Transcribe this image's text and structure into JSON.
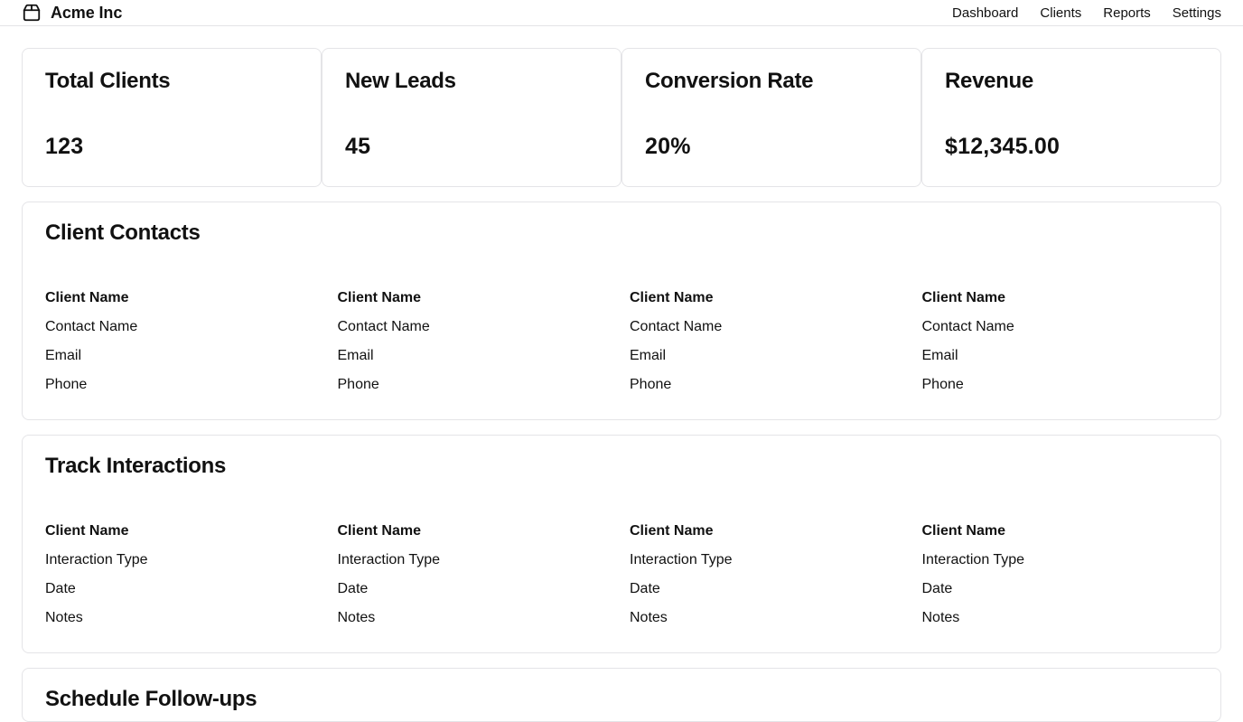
{
  "header": {
    "brand": "Acme Inc",
    "logo_icon": "package-icon",
    "nav": [
      "Dashboard",
      "Clients",
      "Reports",
      "Settings"
    ]
  },
  "stats": [
    {
      "title": "Total Clients",
      "value": "123"
    },
    {
      "title": "New Leads",
      "value": "45"
    },
    {
      "title": "Conversion Rate",
      "value": "20%"
    },
    {
      "title": "Revenue",
      "value": "$12,345.00"
    }
  ],
  "client_contacts": {
    "title": "Client Contacts",
    "columns": [
      {
        "name": "Client Name",
        "contact": "Contact Name",
        "email": "Email",
        "phone": "Phone"
      },
      {
        "name": "Client Name",
        "contact": "Contact Name",
        "email": "Email",
        "phone": "Phone"
      },
      {
        "name": "Client Name",
        "contact": "Contact Name",
        "email": "Email",
        "phone": "Phone"
      },
      {
        "name": "Client Name",
        "contact": "Contact Name",
        "email": "Email",
        "phone": "Phone"
      }
    ]
  },
  "track_interactions": {
    "title": "Track Interactions",
    "columns": [
      {
        "name": "Client Name",
        "type": "Interaction Type",
        "date": "Date",
        "notes": "Notes"
      },
      {
        "name": "Client Name",
        "type": "Interaction Type",
        "date": "Date",
        "notes": "Notes"
      },
      {
        "name": "Client Name",
        "type": "Interaction Type",
        "date": "Date",
        "notes": "Notes"
      },
      {
        "name": "Client Name",
        "type": "Interaction Type",
        "date": "Date",
        "notes": "Notes"
      }
    ]
  },
  "schedule_followups": {
    "title": "Schedule Follow-ups"
  }
}
